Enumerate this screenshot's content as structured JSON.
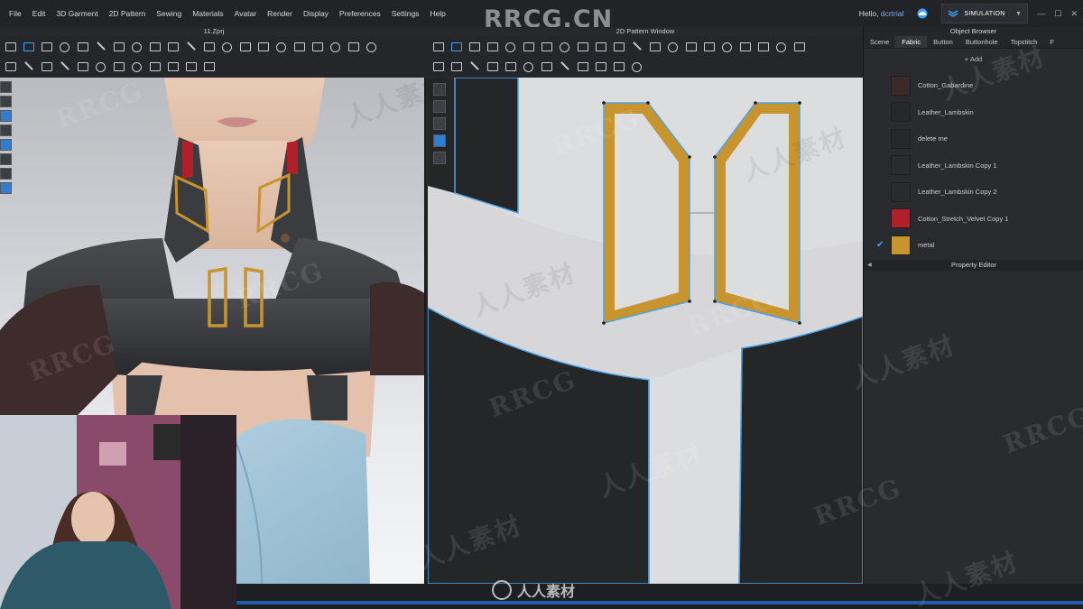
{
  "menubar": {
    "items": [
      "File",
      "Edit",
      "3D Garment",
      "2D Pattern",
      "Sewing",
      "Materials",
      "Avatar",
      "Render",
      "Display",
      "Preferences",
      "Settings",
      "Help"
    ],
    "greeting": "Hello,",
    "username": "dcrtrial",
    "mode_label": "SIMULATION"
  },
  "watermark": {
    "logo_text": "RRCG.CN",
    "repeat_text": [
      "RRCG",
      "人人素材"
    ],
    "bottom_text": "人人素材"
  },
  "window_3d": {
    "title": "11.Zprj"
  },
  "window_2d": {
    "title": "2D Pattern Window"
  },
  "object_browser": {
    "title": "Object Browser",
    "tabs": [
      "Scene",
      "Fabric",
      "Button",
      "Buttonhole",
      "Topstitch",
      "F"
    ],
    "active_tab": "Fabric",
    "add_label": "+ Add",
    "fabrics": [
      {
        "name": "Cotton_Gabardine",
        "color": "#3a2a2a",
        "checked": false
      },
      {
        "name": "Leather_Lambskin",
        "color": "#262729",
        "checked": false
      },
      {
        "name": "delete me",
        "color": "#262729",
        "checked": false
      },
      {
        "name": "Leather_Lambskin Copy 1",
        "color": "#2a2b2d",
        "checked": false
      },
      {
        "name": "Leather_Lambskin Copy 2",
        "color": "#2a2b2d",
        "checked": false
      },
      {
        "name": "Cotton_Stretch_Velvet Copy 1",
        "color": "#b0202a",
        "checked": false
      },
      {
        "name": "metal",
        "color": "#c8942e",
        "checked": true
      }
    ]
  },
  "property_editor": {
    "title": "Property Editor"
  },
  "colors": {
    "accent_blue": "#3aa3ff",
    "metal_gold": "#c8942e",
    "pattern_board": "#dcdddf",
    "leather_dark": "#252628",
    "velvet_red": "#b0202a"
  }
}
